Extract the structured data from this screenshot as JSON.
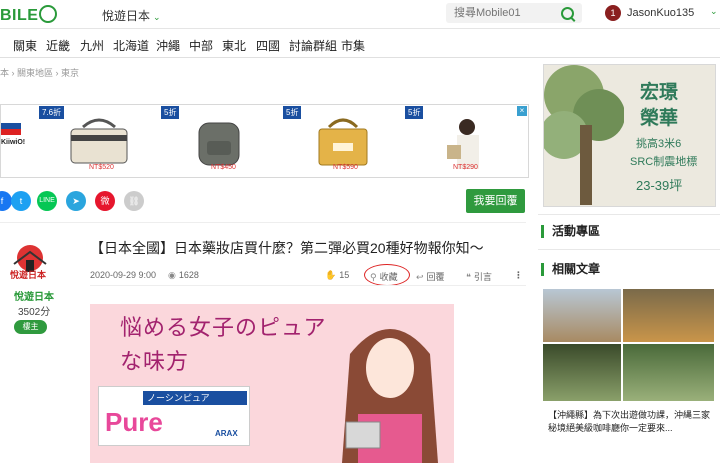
{
  "header": {
    "logo_text": "BILE",
    "section_switcher": "悅遊日本",
    "search_placeholder": "搜尋Mobile01",
    "notification_count": "1",
    "username": "JasonKuo135"
  },
  "nav": {
    "items": [
      "關東",
      "近畿",
      "九州",
      "北海道",
      "沖繩",
      "中部",
      "東北",
      "四國",
      "討論群組",
      "市集"
    ]
  },
  "breadcrumb": [
    "本",
    "關東地區",
    "東京"
  ],
  "ad_banner": {
    "items": [
      {
        "discount": "7.6折",
        "price": "NT$520"
      },
      {
        "discount": "5折",
        "price": "NT$450"
      },
      {
        "discount": "5折",
        "price": "NT$590"
      },
      {
        "discount": "5折",
        "price": "NT$290"
      }
    ],
    "brand_partial": "KiiwiO!"
  },
  "share": {
    "line_label": "LINE",
    "reply_button": "我要回覆"
  },
  "article": {
    "title": "【日本全國】日本藥妝店買什麼？第二彈必買20種好物報你知～",
    "date": "2020-09-29 9:00",
    "views": "1628",
    "likes": "15",
    "bookmark": "收藏",
    "reply": "回覆",
    "quote": "引言",
    "image_text": "悩める女子のピュアな味方",
    "product_name": "ノーシンピュア",
    "product_brand": "ARAX"
  },
  "author": {
    "avatar_text": "悅遊日本",
    "name": "悅遊日本",
    "score": "3502分",
    "badge": "樓主"
  },
  "right_ad": {
    "line1": "宏璟",
    "line2": "榮華",
    "line3": "挑高3米6",
    "line4": "SRC制震地標",
    "line5": "23-39坪"
  },
  "sidebar": {
    "events_heading": "活動專區",
    "related_heading": "相關文章",
    "related_caption": "【沖繩縣】為下次出遊做功課，沖縄三家秘境絕美級咖啡廳你一定要來..."
  },
  "colors": {
    "brand_green": "#2a9a3a",
    "alert_red": "#d22222"
  }
}
